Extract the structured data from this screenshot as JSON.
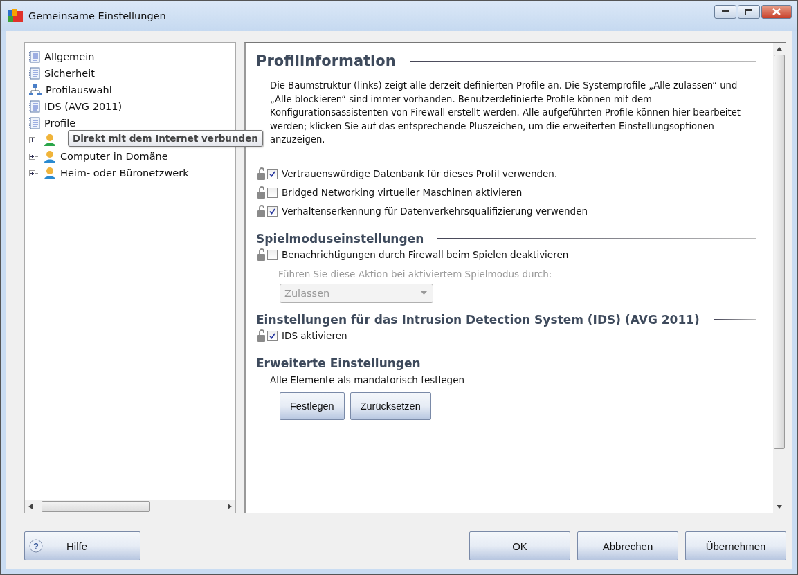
{
  "window": {
    "title": "Gemeinsame Einstellungen"
  },
  "tree": [
    {
      "label": "Allgemein",
      "kind": "page"
    },
    {
      "label": "Sicherheit",
      "kind": "page"
    },
    {
      "label": "Profilauswahl",
      "kind": "network"
    },
    {
      "label": "IDS (AVG 2011)",
      "kind": "page"
    },
    {
      "label": "Profile",
      "kind": "page"
    },
    {
      "label": "Direkt mit dem Internet verbunden",
      "kind": "profile",
      "expanded": false,
      "hovered": true
    },
    {
      "label": "Computer in Domäne",
      "kind": "profile",
      "expanded": false,
      "hovered": false
    },
    {
      "label": "Heim- oder Büronetzwerk",
      "kind": "profile",
      "expanded": false,
      "hovered": false
    }
  ],
  "sections": [
    {
      "title": "Profilinformation",
      "items": [
        {
          "kind": "text",
          "text": "Die Baumstruktur (links) zeigt alle derzeit definierten Profile an. Die Systemprofile „Alle zulassen“ und „Alle blockieren“ sind immer vorhanden. Benutzerdefinierte Profile können mit dem Konfigurationsassistenten von Firewall erstellt werden. Alle aufgeführten Profile können hier bearbeitet werden; klicken Sie auf das entsprechende Pluszeichen, um die erweiterten Einstellungsoptionen anzuzeigen."
        },
        {
          "kind": "checkbox",
          "label": "Vertrauenswürdige Datenbank für dieses Profil verwenden.",
          "checked": true
        },
        {
          "kind": "checkbox",
          "label": "Bridged Networking virtueller Maschinen aktivieren",
          "checked": false
        },
        {
          "kind": "checkbox",
          "label": "Verhaltenserkennung für Datenverkehrsqualifizierung verwenden",
          "checked": true
        }
      ]
    },
    {
      "title": "Spielmoduseinstellungen",
      "items": [
        {
          "kind": "checkbox",
          "label": "Benachrichtigungen durch Firewall beim Spielen deaktivieren",
          "checked": false
        },
        {
          "kind": "note",
          "text": "Führen Sie diese Aktion bei aktiviertem Spielmodus durch:",
          "disabled": true
        },
        {
          "kind": "dropdown",
          "value": "Zulassen",
          "disabled": true
        }
      ]
    },
    {
      "title": "Einstellungen für das Intrusion Detection System (IDS) (AVG 2011)",
      "items": [
        {
          "kind": "checkbox",
          "label": "IDS aktivieren",
          "checked": true
        }
      ]
    },
    {
      "title": "Erweiterte Einstellungen",
      "items": [
        {
          "kind": "note",
          "text": "Alle Elemente als mandatorisch festlegen",
          "disabled": false
        },
        {
          "kind": "buttons",
          "buttons": [
            "Festlegen",
            "Zurücksetzen"
          ]
        }
      ]
    }
  ],
  "help_button": "Hilfe",
  "help_icon": "?",
  "buttons": [
    "OK",
    "Abbrechen",
    "Übernehmen"
  ]
}
